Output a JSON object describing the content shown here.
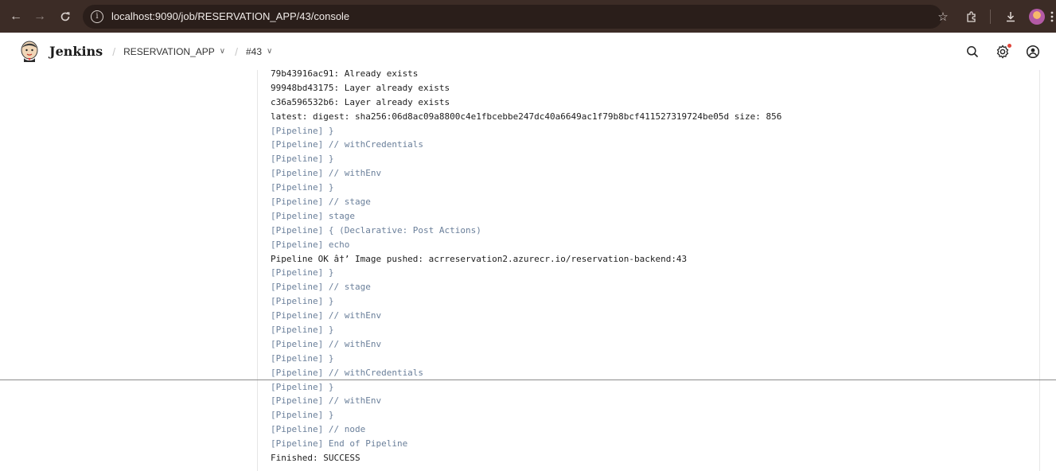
{
  "browser": {
    "url": "localhost:9090/job/RESERVATION_APP/43/console",
    "icons": [
      "back-icon",
      "forward-icon",
      "reload-icon",
      "site-info-icon",
      "bookmark-star-icon",
      "extensions-icon",
      "download-icon",
      "profile-icon",
      "more-icon"
    ]
  },
  "header": {
    "app_title": "Jenkins",
    "breadcrumbs": [
      {
        "label": "RESERVATION_APP"
      },
      {
        "label": "#43"
      }
    ],
    "icons": [
      "search-icon",
      "settings-icon",
      "account-icon"
    ]
  },
  "console": {
    "lines": [
      {
        "text": "79b43916ac91: Already exists",
        "kind": "plain"
      },
      {
        "text": "99948bd43175: Layer already exists",
        "kind": "plain"
      },
      {
        "text": "c36a596532b6: Layer already exists",
        "kind": "plain"
      },
      {
        "text": "latest: digest: sha256:06d8ac09a8800c4e1fbcebbe247dc40a6649ac1f79b8bcf411527319724be05d size: 856",
        "kind": "plain"
      },
      {
        "text": "[Pipeline] }",
        "kind": "pipeline"
      },
      {
        "text": "[Pipeline] // withCredentials",
        "kind": "pipeline"
      },
      {
        "text": "[Pipeline] }",
        "kind": "pipeline"
      },
      {
        "text": "[Pipeline] // withEnv",
        "kind": "pipeline"
      },
      {
        "text": "[Pipeline] }",
        "kind": "pipeline"
      },
      {
        "text": "[Pipeline] // stage",
        "kind": "pipeline"
      },
      {
        "text": "[Pipeline] stage",
        "kind": "pipeline"
      },
      {
        "text": "[Pipeline] { (Declarative: Post Actions)",
        "kind": "pipeline"
      },
      {
        "text": "[Pipeline] echo",
        "kind": "pipeline"
      },
      {
        "text": "Pipeline OK â†’ Image pushed: acrreservation2.azurecr.io/reservation-backend:43",
        "kind": "plain"
      },
      {
        "text": "[Pipeline] }",
        "kind": "pipeline"
      },
      {
        "text": "[Pipeline] // stage",
        "kind": "pipeline"
      },
      {
        "text": "[Pipeline] }",
        "kind": "pipeline"
      },
      {
        "text": "[Pipeline] // withEnv",
        "kind": "pipeline"
      },
      {
        "text": "[Pipeline] }",
        "kind": "pipeline"
      },
      {
        "text": "[Pipeline] // withEnv",
        "kind": "pipeline"
      },
      {
        "text": "[Pipeline] }",
        "kind": "pipeline"
      },
      {
        "text": "[Pipeline] // withCredentials",
        "kind": "pipeline"
      },
      {
        "text": "[Pipeline] }",
        "kind": "pipeline"
      },
      {
        "text": "[Pipeline] // withEnv",
        "kind": "pipeline"
      },
      {
        "text": "[Pipeline] }",
        "kind": "pipeline"
      },
      {
        "text": "[Pipeline] // node",
        "kind": "pipeline"
      },
      {
        "text": "[Pipeline] End of Pipeline",
        "kind": "pipeline"
      },
      {
        "text": "Finished: SUCCESS",
        "kind": "plain"
      }
    ]
  }
}
